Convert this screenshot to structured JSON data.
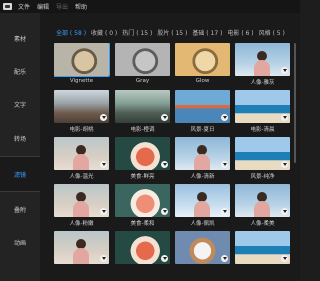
{
  "menubar": {
    "items": [
      {
        "label": "文件",
        "disabled": false
      },
      {
        "label": "编辑",
        "disabled": false
      },
      {
        "label": "导出",
        "disabled": true
      },
      {
        "label": "帮助",
        "disabled": false
      }
    ]
  },
  "sidebar": {
    "items": [
      {
        "label": "素材",
        "active": false
      },
      {
        "label": "配乐",
        "active": false
      },
      {
        "label": "文字",
        "active": false
      },
      {
        "label": "转场",
        "active": false
      },
      {
        "label": "滤镜",
        "active": true
      },
      {
        "label": "叠附",
        "active": false
      },
      {
        "label": "动画",
        "active": false
      }
    ]
  },
  "filter_tabs": [
    {
      "label": "全部 ( 58 )",
      "active": true
    },
    {
      "label": "收藏 ( 0 )",
      "active": false
    },
    {
      "label": "热门 ( 15 )",
      "active": false
    },
    {
      "label": "胶片 ( 15 )",
      "active": false
    },
    {
      "label": "基础 ( 17 )",
      "active": false
    },
    {
      "label": "电影 ( 6 )",
      "active": false
    },
    {
      "label": "风格 ( 5 )",
      "active": false
    }
  ],
  "filters": [
    {
      "label": "Vignette",
      "thumb": "cat",
      "download": false,
      "selected": true
    },
    {
      "label": "Gray",
      "thumb": "cat gray",
      "download": false,
      "selected": false
    },
    {
      "label": "Glow",
      "thumb": "cat glow",
      "download": false,
      "selected": false
    },
    {
      "label": "人像-雅灰",
      "thumb": "person",
      "download": true,
      "selected": false
    },
    {
      "label": "电影-胡桃",
      "thumb": "city",
      "download": true,
      "selected": false
    },
    {
      "label": "电影-橙调",
      "thumb": "city green",
      "download": true,
      "selected": false
    },
    {
      "label": "风景-夏日",
      "thumb": "bridge",
      "download": true,
      "selected": false
    },
    {
      "label": "电影-清晨",
      "thumb": "beach",
      "download": true,
      "selected": false
    },
    {
      "label": "人像-温光",
      "thumb": "person warm",
      "download": true,
      "selected": false
    },
    {
      "label": "美食-鲜亮",
      "thumb": "food",
      "download": true,
      "selected": false
    },
    {
      "label": "人像-清新",
      "thumb": "person",
      "download": true,
      "selected": false
    },
    {
      "label": "风景-纯净",
      "thumb": "beach",
      "download": true,
      "selected": false
    },
    {
      "label": "人像-粉嫩",
      "thumb": "person warm",
      "download": true,
      "selected": false
    },
    {
      "label": "美食-柔和",
      "thumb": "food soft",
      "download": true,
      "selected": false
    },
    {
      "label": "人像-佩凯",
      "thumb": "person cool",
      "download": true,
      "selected": false
    },
    {
      "label": "人像-柔美",
      "thumb": "person",
      "download": true,
      "selected": false
    },
    {
      "label": "",
      "thumb": "person warm",
      "download": true,
      "selected": false
    },
    {
      "label": "",
      "thumb": "food",
      "download": true,
      "selected": false
    },
    {
      "label": "",
      "thumb": "cat2",
      "download": true,
      "selected": false
    },
    {
      "label": "",
      "thumb": "beach",
      "download": true,
      "selected": false
    }
  ],
  "colors": {
    "accent": "#3aa0ff"
  }
}
